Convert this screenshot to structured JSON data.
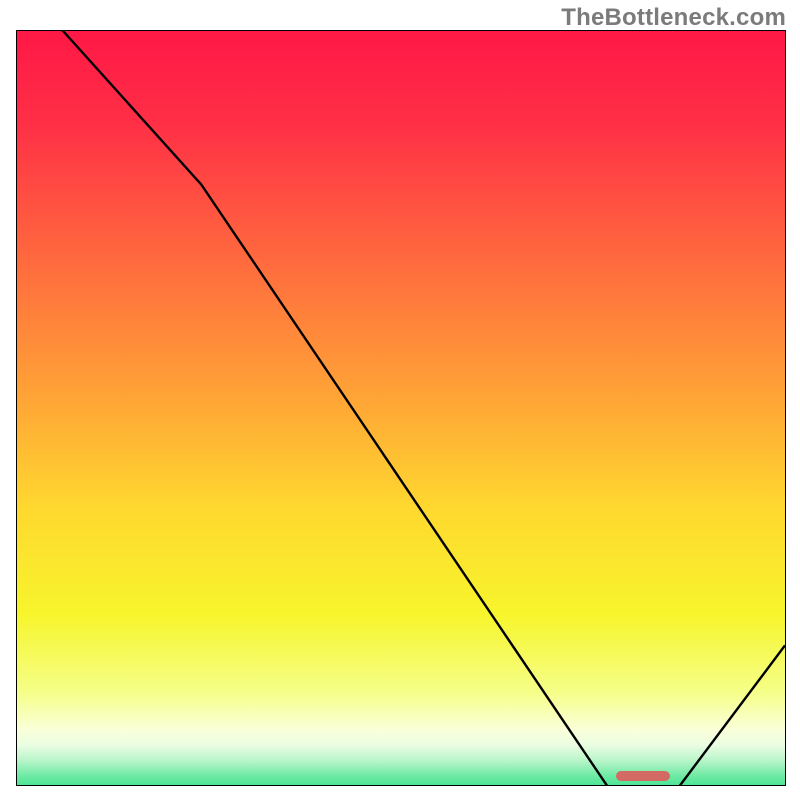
{
  "watermark": "TheBottleneck.com",
  "chart_data": {
    "type": "line",
    "title": "",
    "xlabel": "",
    "ylabel": "",
    "xlim": [
      0,
      100
    ],
    "ylim": [
      0,
      100
    ],
    "x": [
      0,
      6,
      24,
      78,
      85,
      100
    ],
    "values": [
      105,
      100,
      80,
      0,
      0,
      20
    ],
    "annotations": [
      {
        "kind": "optimal_zone",
        "x_start": 78,
        "x_end": 85,
        "y": 0
      }
    ],
    "background_gradient": [
      {
        "pct": 0,
        "color": "#ff1846"
      },
      {
        "pct": 12,
        "color": "#ff2f46"
      },
      {
        "pct": 30,
        "color": "#ff6a3e"
      },
      {
        "pct": 48,
        "color": "#ffa536"
      },
      {
        "pct": 62,
        "color": "#ffd82f"
      },
      {
        "pct": 76,
        "color": "#f7f52c"
      },
      {
        "pct": 86,
        "color": "#f5ff87"
      },
      {
        "pct": 91,
        "color": "#faffd9"
      },
      {
        "pct": 93,
        "color": "#eafde2"
      },
      {
        "pct": 95,
        "color": "#b8f5c9"
      },
      {
        "pct": 97,
        "color": "#6eeaa4"
      },
      {
        "pct": 100,
        "color": "#18df81"
      }
    ]
  }
}
